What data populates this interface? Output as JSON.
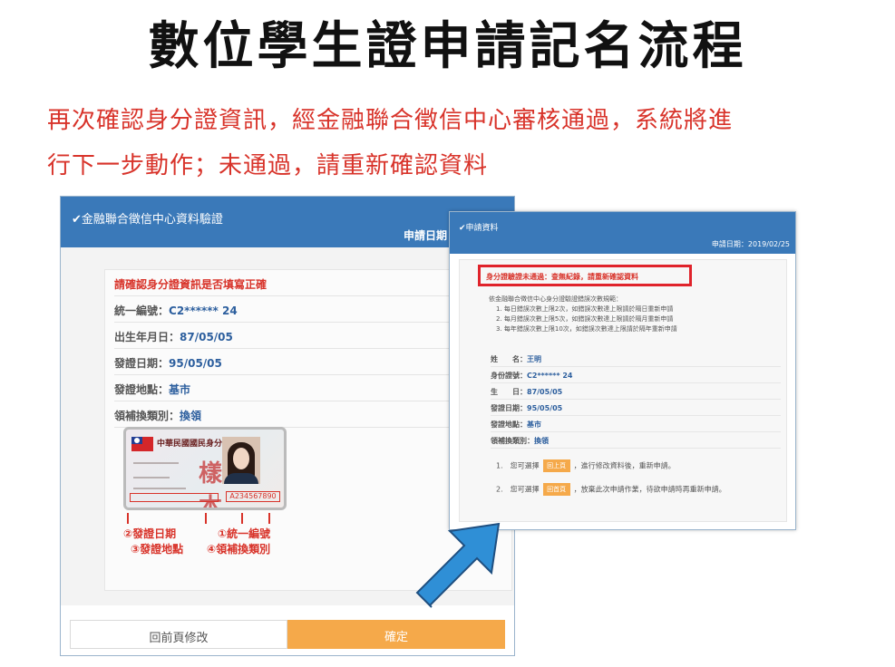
{
  "title": "數位學生證申請記名流程",
  "subtitle": {
    "line1": "再次確認身分證資訊，經金融聯合徵信中心審核通過，系統將進",
    "line2": "行下一步動作；未通過，請重新確認資料"
  },
  "panel1": {
    "header_title": "✔金融聯合徵信中心資料驗證",
    "header_date": "申請日期",
    "warning": "請確認身分證資訊是否填寫正確",
    "rows": [
      {
        "label": "統一編號：",
        "value": "C2****** 24"
      },
      {
        "label": "出生年月日：",
        "value": "87/05/05"
      },
      {
        "label": "發證日期：",
        "value": "95/05/05"
      },
      {
        "label": "發證地點：",
        "value": "基市"
      },
      {
        "label": "領補換類別：",
        "value": "換領"
      }
    ],
    "card": {
      "title": "中華民國國民身分證",
      "stamp": "樣本",
      "id_number": "A234567890"
    },
    "annotations": {
      "a1": "②發證日期",
      "a2": "①統一編號",
      "a3": "③發證地點",
      "a4": "④領補換類別"
    },
    "button_back": "回前頁修改",
    "button_confirm": "確定"
  },
  "panel2": {
    "header_title": "✔申請資料",
    "header_date": "申請日期：2019/02/25",
    "alert": "身分證驗證未通過：查無紀錄，請重新確認資料",
    "rules_intro": "依金融聯合徵信中心身分證驗證錯誤次數規範：",
    "rules": [
      "1. 每日錯誤次數上限2次，如錯誤次數達上限請於隔日重新申請",
      "2. 每月錯誤次數上限5次，如錯誤次數達上限請於隔月重新申請",
      "3. 每年錯誤次數上限10次，如錯誤次數達上限請於隔年重新申請"
    ],
    "rows": [
      {
        "label": "姓　　名：",
        "value": "王明"
      },
      {
        "label": "身份證號：",
        "value": "C2****** 24"
      },
      {
        "label": "生　　日：",
        "value": "87/05/05"
      },
      {
        "label": "發證日期：",
        "value": "95/05/05"
      },
      {
        "label": "發證地點：",
        "value": "基市"
      },
      {
        "label": "領補換類別：",
        "value": "換領"
      }
    ],
    "option1": {
      "prefix": "1.　您可選擇",
      "button": "回上頁",
      "suffix": "，進行修改資料後，重新申請。"
    },
    "option2": {
      "prefix": "2.　您可選擇",
      "button": "回首頁",
      "suffix": "，放棄此次申請作業，待欲申請時再重新申請。"
    }
  },
  "colors": {
    "header_blue": "#3a79b9",
    "accent_orange": "#f5a94a",
    "alert_red": "#e0232b",
    "arrow_blue": "#2f8fd6"
  }
}
